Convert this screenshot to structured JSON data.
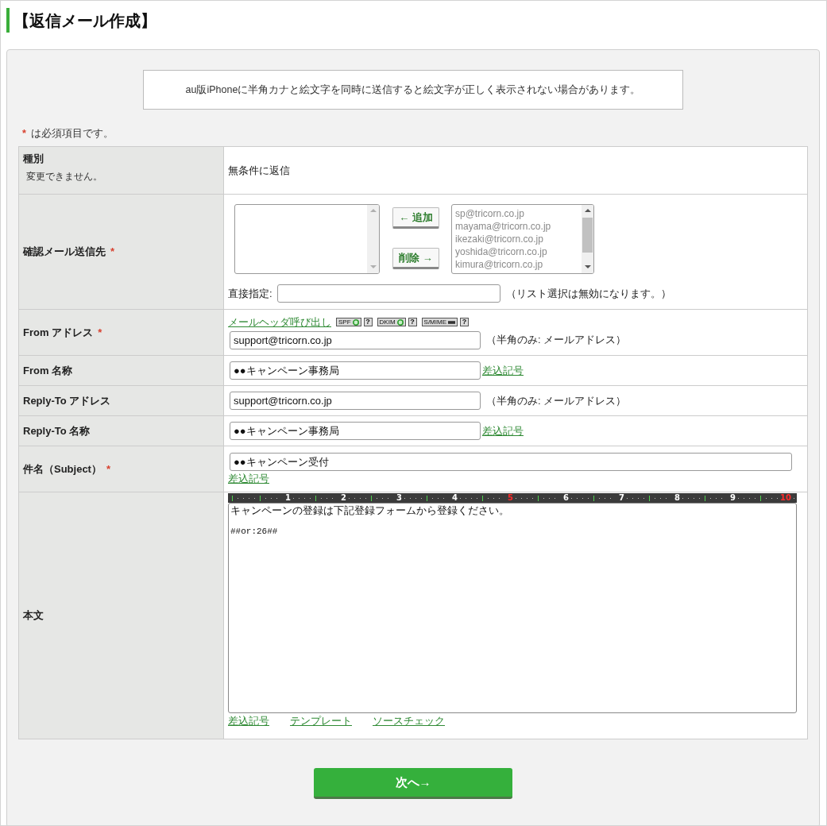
{
  "page_title": "【返信メール作成】",
  "notice": "au版iPhoneに半角カナと絵文字を同時に送信すると絵文字が正しく表示されない場合があります。",
  "required_note": {
    "mark": "*",
    "text": "は必須項目です。"
  },
  "form": {
    "rows": [
      {
        "kind": "static",
        "label": "種別",
        "sublabel": "変更できません。",
        "value": "無条件に返信"
      },
      {
        "kind": "recipients",
        "label": "確認メール送信先",
        "required_mark": "*",
        "add_button": "← 追加",
        "remove_button": "削除 →",
        "selected_addresses": [
          {
            "text": "sp@tricorn.co.jp",
            "selected": false
          },
          {
            "text": "mayama@tricorn.co.jp",
            "selected": false
          },
          {
            "text": "ikezaki@tricorn.co.jp",
            "selected": false
          },
          {
            "text": "yoshida@tricorn.co.jp",
            "selected": false
          },
          {
            "text": "kimura@tricorn.co.jp",
            "selected": false
          }
        ],
        "direct_label": "直接指定:",
        "direct_note": "（リスト選択は無効になります。）"
      },
      {
        "kind": "address",
        "label": "From アドレス",
        "required_mark": "*",
        "header_link": "メールヘッダ呼び出し",
        "badges": [
          {
            "label": "SPF",
            "kind": "active",
            "help": "?"
          },
          {
            "label": "DKIM",
            "kind": "active",
            "help": "?"
          },
          {
            "label": "S/MIME",
            "kind": "inactive",
            "help": "?"
          }
        ],
        "value": "support@tricorn.co.jp",
        "note": "（半角のみ: メールアドレス）"
      },
      {
        "kind": "name",
        "label": "From 名称",
        "value": "●●キャンペーン事務局",
        "link": "差込記号"
      },
      {
        "kind": "address",
        "label": "Reply-To アドレス",
        "value": "support@tricorn.co.jp",
        "note": "（半角のみ: メールアドレス）"
      },
      {
        "kind": "name",
        "label": "Reply-To 名称",
        "value": "●●キャンペーン事務局",
        "link": "差込記号"
      },
      {
        "kind": "subject",
        "label": "件名（Subject）",
        "required_mark": "*",
        "value": "●●キャンペーン受付",
        "link": "差込記号"
      },
      {
        "kind": "body",
        "label": "本文",
        "ruler": [
          {
            "label": "1",
            "kind": "minor"
          },
          {
            "label": "2",
            "kind": "minor"
          },
          {
            "label": "3",
            "kind": "minor"
          },
          {
            "label": "4",
            "kind": "minor"
          },
          {
            "label": "5",
            "kind": "major"
          },
          {
            "label": "6",
            "kind": "minor"
          },
          {
            "label": "7",
            "kind": "minor"
          },
          {
            "label": "8",
            "kind": "minor"
          },
          {
            "label": "9",
            "kind": "minor"
          },
          {
            "label": "10",
            "kind": "major"
          }
        ],
        "paragraphs": [
          "キャンペーンの登録は下記登録フォームから登録ください。",
          "##or:26##"
        ],
        "links": [
          "差込記号",
          "テンプレート",
          "ソースチェック"
        ]
      }
    ]
  },
  "next_button": "次へ→"
}
